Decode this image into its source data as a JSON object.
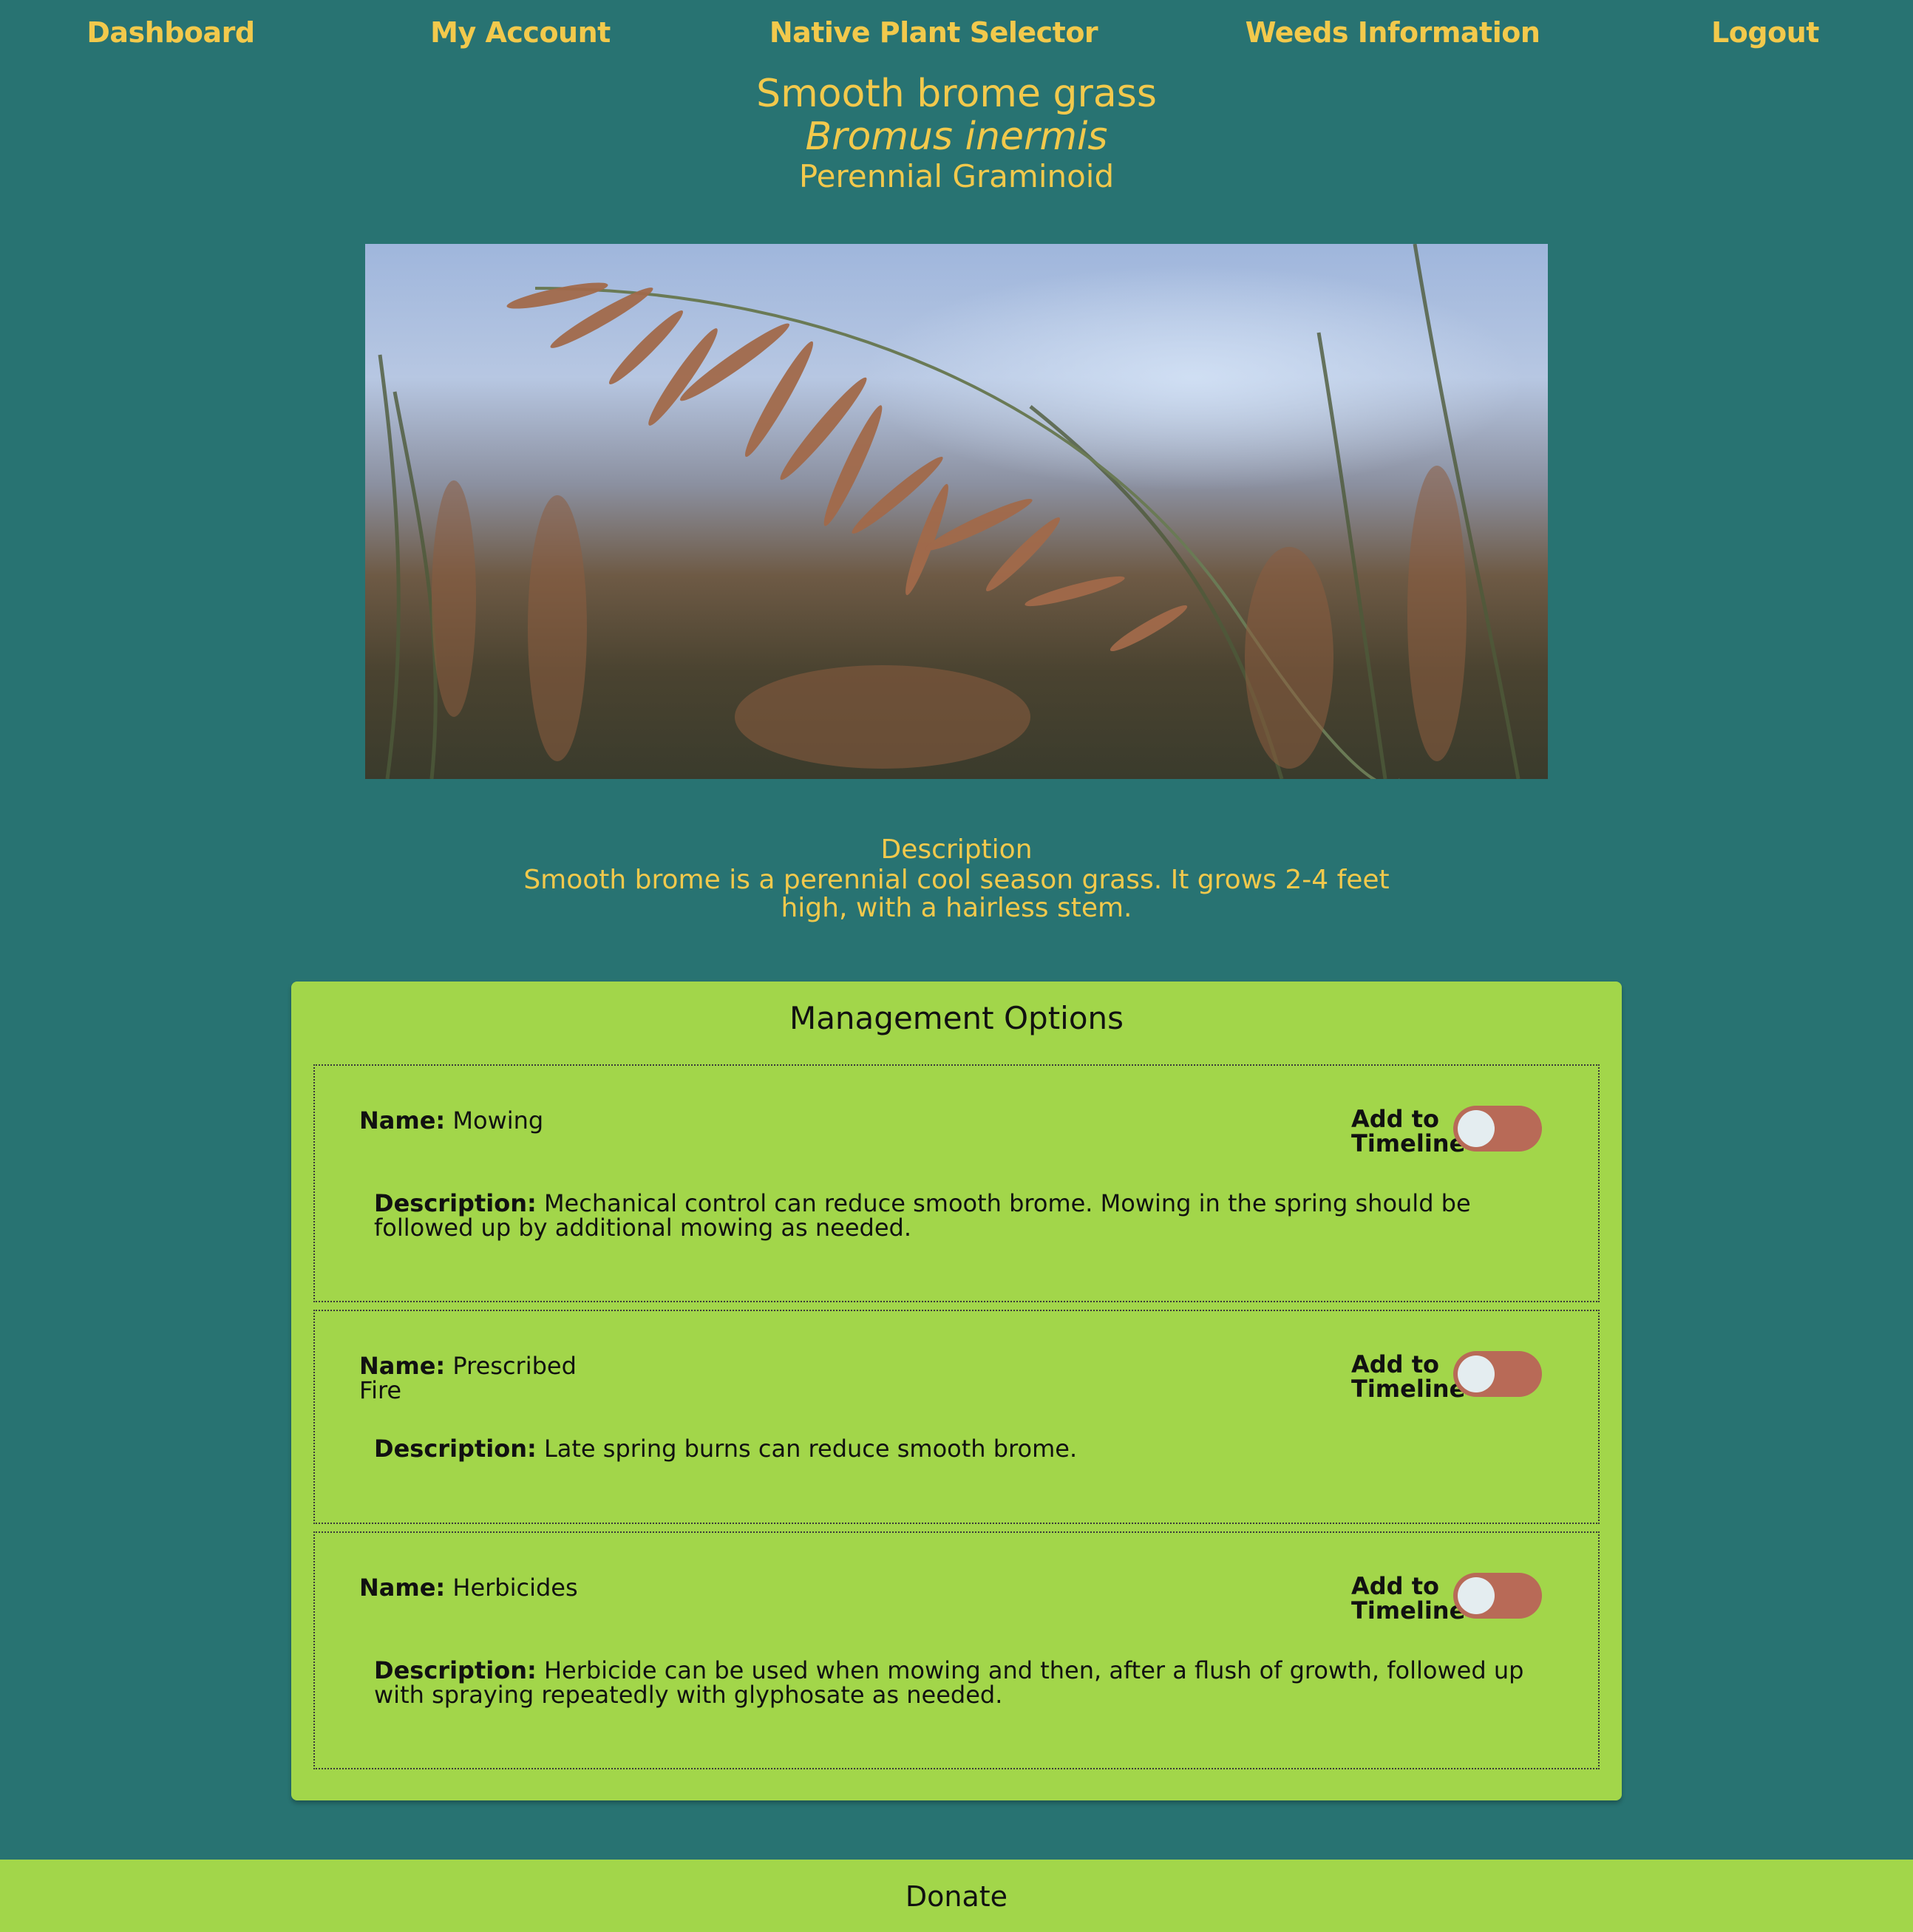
{
  "nav": {
    "items": [
      {
        "label": "Dashboard"
      },
      {
        "label": "My Account"
      },
      {
        "label": "Native Plant Selector"
      },
      {
        "label": "Weeds Information"
      },
      {
        "label": "Logout"
      }
    ]
  },
  "plant": {
    "common_name": "Smooth brome grass",
    "scientific_name": "Bromus inermis",
    "type": "Perennial Graminoid",
    "description_heading": "Description",
    "description": "Smooth brome is a perennial cool season grass. It grows 2-4 feet high, with a hairless stem."
  },
  "management": {
    "title": "Management Options",
    "name_label": "Name:",
    "description_label": "Description:",
    "toggle_label": "Add to Timeline",
    "options": [
      {
        "name": "Mowing",
        "description": "Mechanical control can reduce smooth brome. Mowing in the spring should be followed up by additional mowing as needed.",
        "added": false
      },
      {
        "name": "Prescribed Fire",
        "description": "Late spring burns can reduce smooth brome.",
        "added": false
      },
      {
        "name": "Herbicides",
        "description": "Herbicide can be used when mowing and then, after a flush of growth, followed up with spraying repeatedly with glyphosate as needed.",
        "added": false
      }
    ]
  },
  "footer": {
    "donate_label": "Donate"
  },
  "colors": {
    "background": "#287372",
    "accent_text": "#f2c94c",
    "panel": "#a2d64a",
    "toggle_off": "#b86a57"
  }
}
